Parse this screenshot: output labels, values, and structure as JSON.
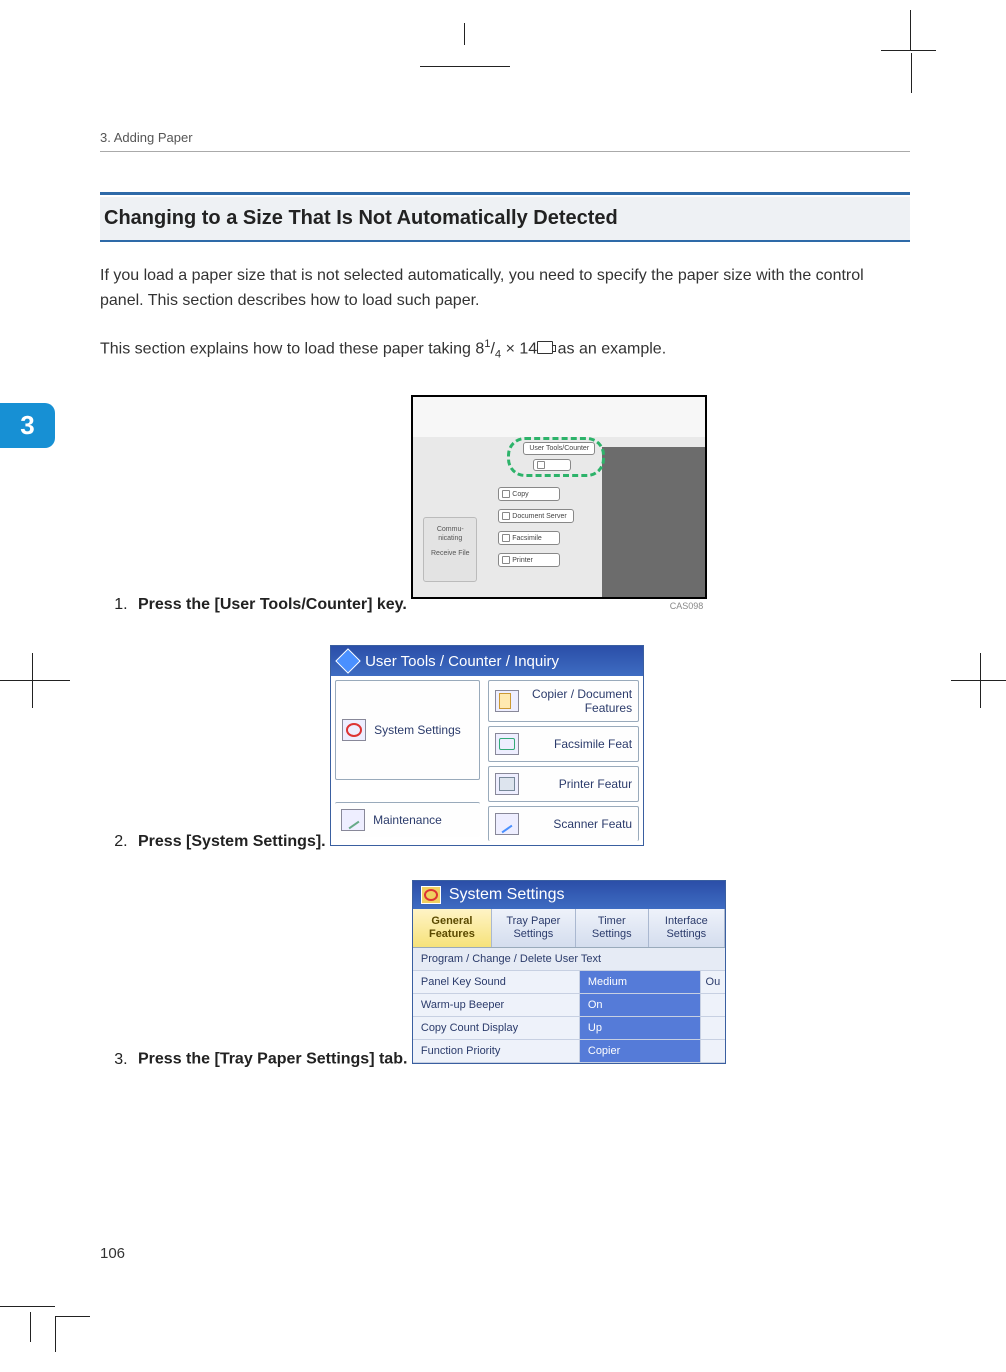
{
  "running_head": "3. Adding Paper",
  "chapter_tab": "3",
  "section_title": "Changing to a Size That Is Not Automatically Detected",
  "intro_p1": "If you load a paper size that is not selected automatically, you need to specify the paper size with the control panel. This section describes how to load such paper.",
  "intro_p2_a": "This section explains how to load these paper taking 8",
  "intro_p2_sup": "1",
  "intro_p2_slash": "/",
  "intro_p2_sub": "4",
  "intro_p2_mid": " × 14",
  "intro_p2_b": " as an example.",
  "steps": {
    "s1": "Press the [User Tools/Counter] key.",
    "s2": "Press [System Settings].",
    "s3": "Press the [Tray Paper Settings] tab."
  },
  "fig1": {
    "caption": "CAS098",
    "side_label_1": "Commu-",
    "side_label_1b": "nicating",
    "side_label_2": "Receive File",
    "btn_usertools": "User Tools/Counter",
    "btn_copy": "Copy",
    "btn_ds": "Document Server",
    "btn_fax": "Facsimile",
    "btn_prn": "Printer"
  },
  "fig2": {
    "title": "User Tools / Counter / Inquiry",
    "system_settings": "System Settings",
    "maintenance": "Maintenance",
    "copier_doc": "Copier / Document Features",
    "fax": "Facsimile Feat",
    "printer": "Printer Featur",
    "scanner": "Scanner Featu"
  },
  "fig3": {
    "title": "System Settings",
    "tabs": {
      "general": "General Features",
      "tray": "Tray Paper Settings",
      "timer": "Timer Settings",
      "iface": "Interface Settings"
    },
    "row_hdr": "Program / Change / Delete User Text",
    "rows": [
      {
        "k": "Panel Key Sound",
        "v": "Medium",
        "x": "Ou"
      },
      {
        "k": "Warm-up Beeper",
        "v": "On",
        "x": ""
      },
      {
        "k": "Copy Count Display",
        "v": "Up",
        "x": ""
      },
      {
        "k": "Function Priority",
        "v": "Copier",
        "x": ""
      }
    ]
  },
  "page_number": "106"
}
